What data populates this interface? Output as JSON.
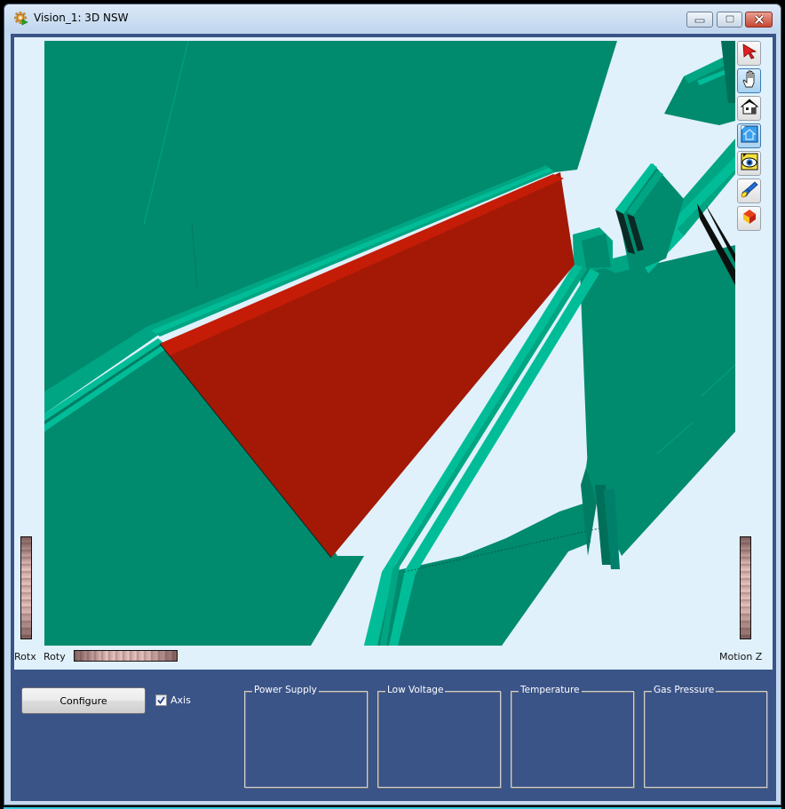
{
  "window": {
    "title": "Vision_1: 3D NSW",
    "icon": "gear-icon",
    "controls": {
      "minimize": "minimize-icon",
      "maximize": "maximize-icon",
      "close": "close-icon"
    }
  },
  "viewer": {
    "background_color": "#e0f1fb",
    "scene_colors": {
      "chamber_face": "#008a6e",
      "chamber_edge_light": "#00bd98",
      "chamber_edge_mid": "#00a583",
      "chamber_shadow": "#006f5a",
      "highlighted_sector": "#a31906",
      "highlighted_sector_edge": "#c41c07",
      "outline_dark": "#0b2a24"
    },
    "toolbar": [
      {
        "name": "select",
        "icon": "arrow-pointer-icon",
        "active": false
      },
      {
        "name": "view",
        "icon": "hand-icon",
        "active": true
      },
      {
        "name": "home",
        "icon": "home-icon",
        "active": false
      },
      {
        "name": "set-home",
        "icon": "set-home-icon",
        "active": true
      },
      {
        "name": "view-all",
        "icon": "eye-icon",
        "active": false
      },
      {
        "name": "seek",
        "icon": "flashlight-icon",
        "active": false
      },
      {
        "name": "projection",
        "icon": "cube-icon",
        "active": false
      }
    ],
    "wheels": {
      "rotx_label": "Rotx",
      "roty_label": "Roty",
      "motionz_label": "Motion Z"
    }
  },
  "controls": {
    "configure_label": "Configure",
    "axis_label": "Axis",
    "axis_checked": true
  },
  "groups": [
    {
      "title": "Power Supply"
    },
    {
      "title": "Low Voltage"
    },
    {
      "title": "Temperature"
    },
    {
      "title": "Gas Pressure"
    }
  ]
}
